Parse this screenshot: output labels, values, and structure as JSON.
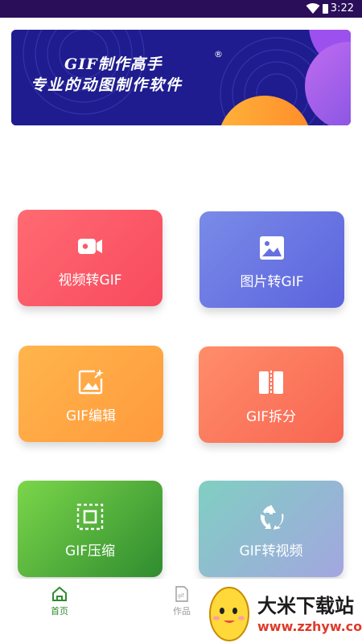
{
  "status_bar": {
    "time": "3:22"
  },
  "banner": {
    "title": "GIF制作高手",
    "registered": "®",
    "subtitle": "专业的动图制作软件"
  },
  "cards": [
    {
      "label": "视频转GIF",
      "icon": "video-camera-icon"
    },
    {
      "label": "图片转GIF",
      "icon": "image-icon"
    },
    {
      "label": "GIF编辑",
      "icon": "image-edit-icon"
    },
    {
      "label": "GIF拆分",
      "icon": "split-icon"
    },
    {
      "label": "GIF压缩",
      "icon": "compress-icon"
    },
    {
      "label": "GIF转视频",
      "icon": "recycle-icon"
    }
  ],
  "bottom_nav": {
    "items": [
      {
        "label": "首页",
        "icon": "home-icon",
        "active": true
      },
      {
        "label": "作品",
        "icon": "gif-file-icon",
        "active": false
      }
    ],
    "active_color": "#2f8c2f"
  },
  "watermark": {
    "title": "大米下载站",
    "url": "www.zzhyw.com"
  }
}
